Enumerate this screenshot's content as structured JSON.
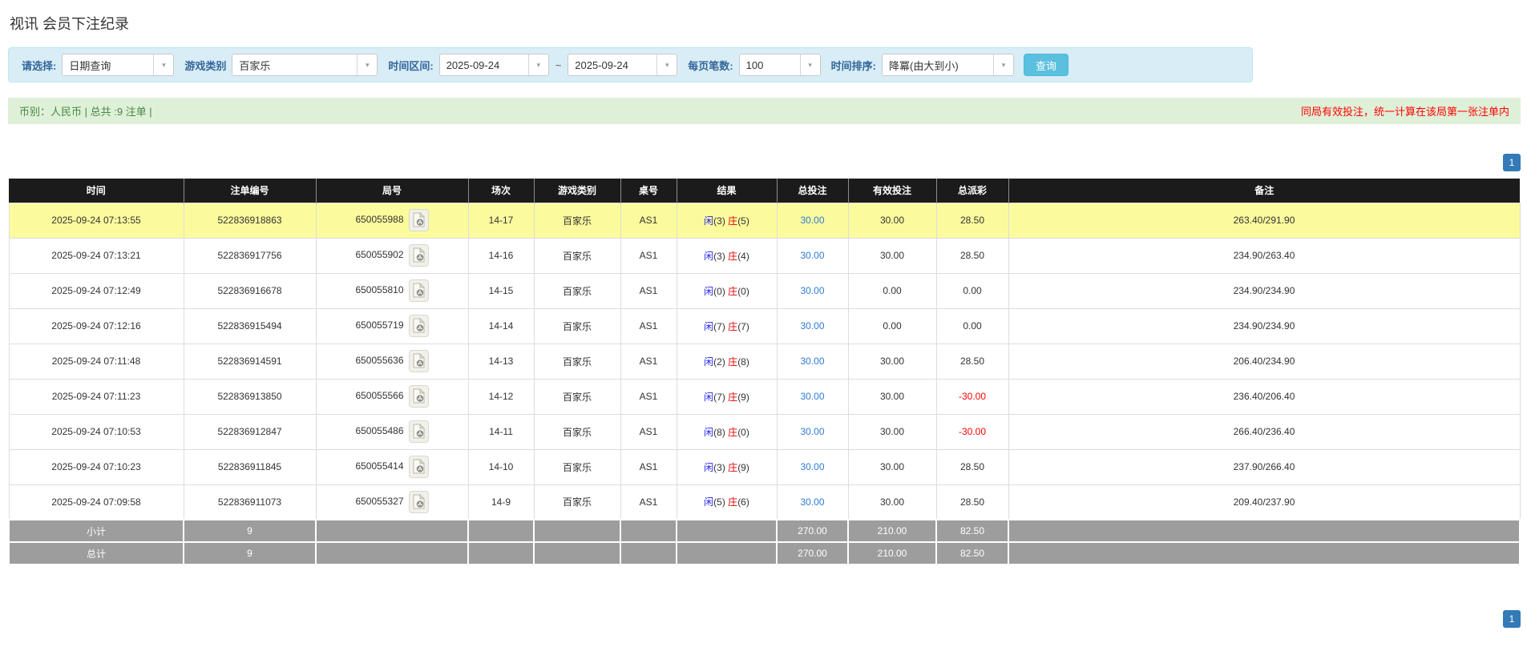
{
  "page": {
    "title": "视讯 会员下注纪录"
  },
  "filters": {
    "select_label": "请选择:",
    "select_value": "日期查询",
    "game_label": "游戏类别",
    "game_value": "百家乐",
    "range_label": "时间区间:",
    "date_from": "2025-09-24",
    "tilde": "~",
    "date_to": "2025-09-24",
    "per_page_label": "每页笔数:",
    "per_page_value": "100",
    "sort_label": "时间排序:",
    "sort_value": "降冪(由大到小)",
    "search_button": "查询",
    "dropdown_arrow_icon": "▾"
  },
  "summary": {
    "left": "币别：人民币 | 总共 :9 注单 |",
    "right": "同局有效投注，统一计算在该局第一张注单内"
  },
  "pagination": {
    "page": "1"
  },
  "table": {
    "headers": [
      "时间",
      "注单编号",
      "局号",
      "场次",
      "游戏类别",
      "桌号",
      "结果",
      "总投注",
      "有效投注",
      "总派彩",
      "备注"
    ],
    "rows": [
      {
        "time": "2025-09-24 07:13:55",
        "bet_id": "522836918863",
        "round": "650055988",
        "session": "14-17",
        "game": "百家乐",
        "table_no": "AS1",
        "player": "闲",
        "player_n": "(3)",
        "banker": "庄",
        "banker_n": "(5)",
        "total_bet": "30.00",
        "valid_bet": "30.00",
        "payout": "28.50",
        "neg": false,
        "remark": "263.40/291.90",
        "highlight": true
      },
      {
        "time": "2025-09-24 07:13:21",
        "bet_id": "522836917756",
        "round": "650055902",
        "session": "14-16",
        "game": "百家乐",
        "table_no": "AS1",
        "player": "闲",
        "player_n": "(3)",
        "banker": "庄",
        "banker_n": "(4)",
        "total_bet": "30.00",
        "valid_bet": "30.00",
        "payout": "28.50",
        "neg": false,
        "remark": "234.90/263.40",
        "highlight": false
      },
      {
        "time": "2025-09-24 07:12:49",
        "bet_id": "522836916678",
        "round": "650055810",
        "session": "14-15",
        "game": "百家乐",
        "table_no": "AS1",
        "player": "闲",
        "player_n": "(0)",
        "banker": "庄",
        "banker_n": "(0)",
        "total_bet": "30.00",
        "valid_bet": "0.00",
        "payout": "0.00",
        "neg": false,
        "remark": "234.90/234.90",
        "highlight": false
      },
      {
        "time": "2025-09-24 07:12:16",
        "bet_id": "522836915494",
        "round": "650055719",
        "session": "14-14",
        "game": "百家乐",
        "table_no": "AS1",
        "player": "闲",
        "player_n": "(7)",
        "banker": "庄",
        "banker_n": "(7)",
        "total_bet": "30.00",
        "valid_bet": "0.00",
        "payout": "0.00",
        "neg": false,
        "remark": "234.90/234.90",
        "highlight": false
      },
      {
        "time": "2025-09-24 07:11:48",
        "bet_id": "522836914591",
        "round": "650055636",
        "session": "14-13",
        "game": "百家乐",
        "table_no": "AS1",
        "player": "闲",
        "player_n": "(2)",
        "banker": "庄",
        "banker_n": "(8)",
        "total_bet": "30.00",
        "valid_bet": "30.00",
        "payout": "28.50",
        "neg": false,
        "remark": "206.40/234.90",
        "highlight": false
      },
      {
        "time": "2025-09-24 07:11:23",
        "bet_id": "522836913850",
        "round": "650055566",
        "session": "14-12",
        "game": "百家乐",
        "table_no": "AS1",
        "player": "闲",
        "player_n": "(7)",
        "banker": "庄",
        "banker_n": "(9)",
        "total_bet": "30.00",
        "valid_bet": "30.00",
        "payout": "-30.00",
        "neg": true,
        "remark": "236.40/206.40",
        "highlight": false
      },
      {
        "time": "2025-09-24 07:10:53",
        "bet_id": "522836912847",
        "round": "650055486",
        "session": "14-11",
        "game": "百家乐",
        "table_no": "AS1",
        "player": "闲",
        "player_n": "(8)",
        "banker": "庄",
        "banker_n": "(0)",
        "total_bet": "30.00",
        "valid_bet": "30.00",
        "payout": "-30.00",
        "neg": true,
        "remark": "266.40/236.40",
        "highlight": false
      },
      {
        "time": "2025-09-24 07:10:23",
        "bet_id": "522836911845",
        "round": "650055414",
        "session": "14-10",
        "game": "百家乐",
        "table_no": "AS1",
        "player": "闲",
        "player_n": "(3)",
        "banker": "庄",
        "banker_n": "(9)",
        "total_bet": "30.00",
        "valid_bet": "30.00",
        "payout": "28.50",
        "neg": false,
        "remark": "237.90/266.40",
        "highlight": false
      },
      {
        "time": "2025-09-24 07:09:58",
        "bet_id": "522836911073",
        "round": "650055327",
        "session": "14-9",
        "game": "百家乐",
        "table_no": "AS1",
        "player": "闲",
        "player_n": "(5)",
        "banker": "庄",
        "banker_n": "(6)",
        "total_bet": "30.00",
        "valid_bet": "30.00",
        "payout": "28.50",
        "neg": false,
        "remark": "209.40/237.90",
        "highlight": false
      }
    ],
    "subtotal": {
      "label": "小计",
      "count": "9",
      "total_bet": "270.00",
      "valid_bet": "210.00",
      "payout": "82.50"
    },
    "total": {
      "label": "总计",
      "count": "9",
      "total_bet": "270.00",
      "valid_bet": "210.00",
      "payout": "82.50"
    }
  },
  "colors": {
    "filter_bar_bg": "#d9edf7",
    "summary_bar_bg": "#dff0d8",
    "summary_text_green": "#468847",
    "notice_red": "#ff0000",
    "header_bg": "#1b1b1b",
    "highlight_yellow": "#fbfb9d",
    "footer_gray": "#9d9d9d",
    "link_blue": "#2e7bd6",
    "player_blue": "#2222ee",
    "banker_red": "#e60000",
    "search_button_blue": "#5bc0de",
    "pagination_blue": "#337ab7"
  }
}
